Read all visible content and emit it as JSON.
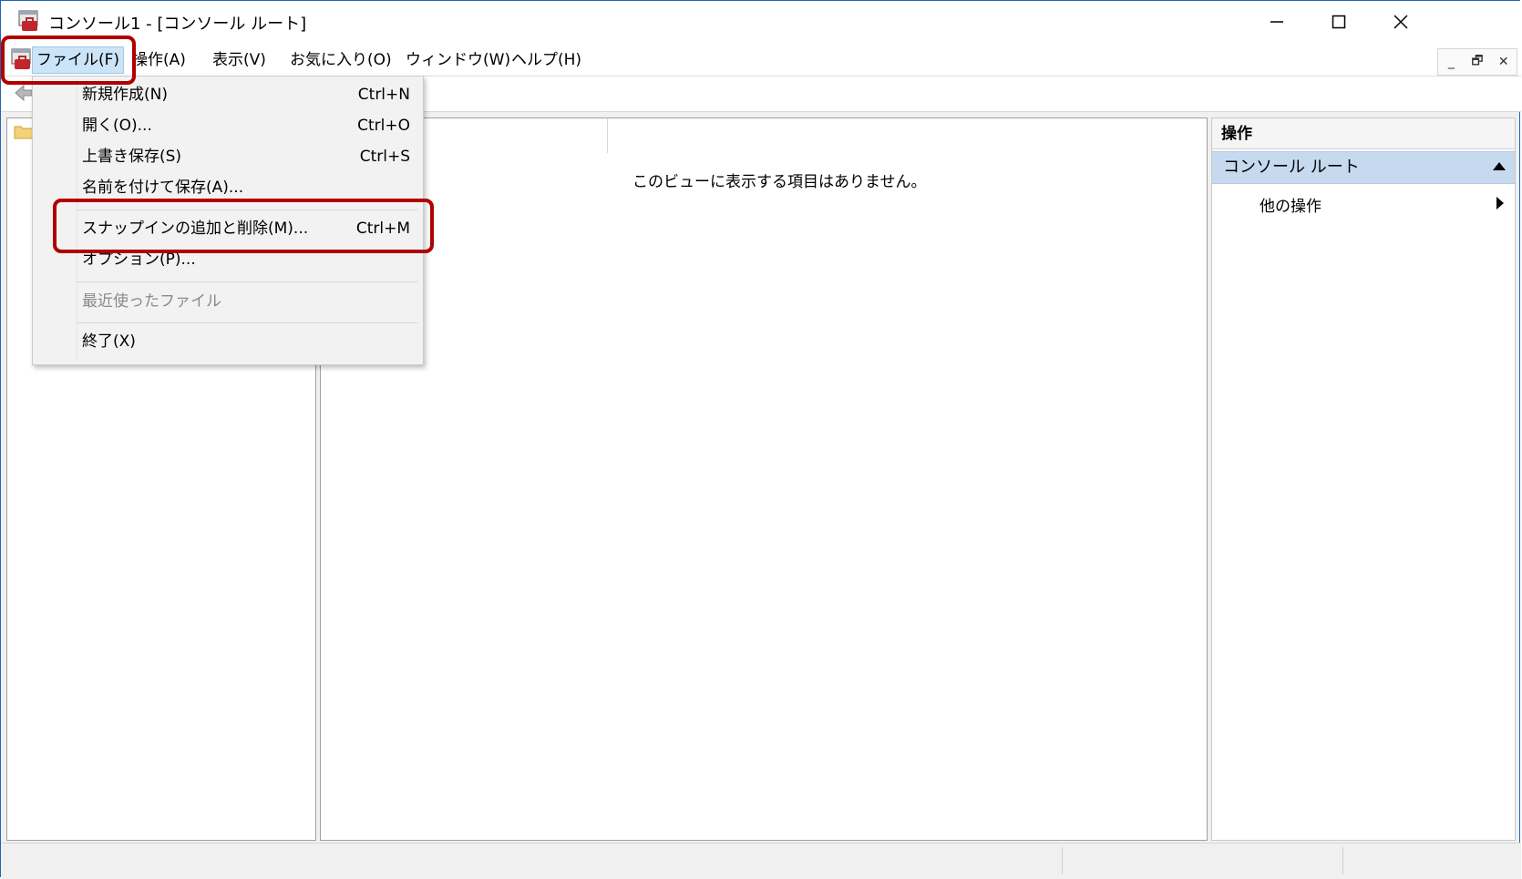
{
  "window": {
    "title": "コンソール1 - [コンソール ルート]",
    "minimize": "─",
    "maximize": "☐",
    "close": "✕"
  },
  "menubar": {
    "items": [
      {
        "label": "ファイル(F)"
      },
      {
        "label": "操作(A)"
      },
      {
        "label": "表示(V)"
      },
      {
        "label": "お気に入り(O)"
      },
      {
        "label": "ウィンドウ(W)"
      },
      {
        "label": "ヘルプ(H)"
      }
    ],
    "mdi_min": "_",
    "mdi_restore": "🗗",
    "mdi_close": "✕"
  },
  "file_menu": {
    "items": [
      {
        "label": "新規作成(N)",
        "shortcut": "Ctrl+N"
      },
      {
        "label": "開く(O)...",
        "shortcut": "Ctrl+O"
      },
      {
        "label": "上書き保存(S)",
        "shortcut": "Ctrl+S"
      },
      {
        "label": "名前を付けて保存(A)...",
        "shortcut": ""
      },
      {
        "label": "スナップインの追加と削除(M)...",
        "shortcut": "Ctrl+M"
      },
      {
        "label": "オプション(P)...",
        "shortcut": ""
      },
      {
        "label": "最近使ったファイル",
        "shortcut": ""
      },
      {
        "label": "終了(X)",
        "shortcut": ""
      }
    ]
  },
  "center": {
    "empty_message": "このビューに表示する項目はありません。"
  },
  "actions_pane": {
    "header": "操作",
    "section": "コンソール ルート",
    "item": "他の操作"
  },
  "colors": {
    "highlight": "#b00000",
    "menu_active": "#cce4f7",
    "section_bg": "#c6d9ef"
  }
}
